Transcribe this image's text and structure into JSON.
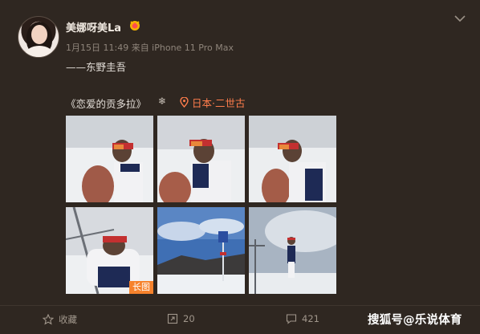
{
  "post": {
    "username": "美娜呀美La",
    "meta": "1月15日 11:49 来自 iPhone 11 Pro Max",
    "text_line": "——东野圭吾",
    "book_title": "《恋爱的贡多拉》",
    "snow_symbol": "❄",
    "location": "日本·二世古",
    "long_image_tag": "长图"
  },
  "actions": {
    "favorite_label": "收藏",
    "repost_count": "20",
    "comment_count": "421"
  },
  "watermark": "搜狐号@乐说体育",
  "colors": {
    "background": "#2f2721",
    "location_accent": "#ff7d4c",
    "tag_bg": "#f6822c"
  },
  "icons": [
    "avatar",
    "vip-badge-icon",
    "chevron-down-icon",
    "location-pin-icon",
    "star-icon",
    "repost-icon",
    "comment-icon"
  ]
}
